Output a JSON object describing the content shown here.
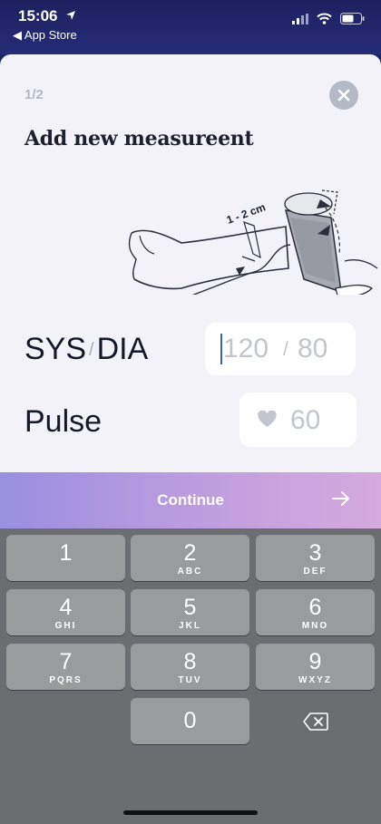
{
  "status_bar": {
    "time": "15:06",
    "back_label": "◀ App Store"
  },
  "sheet": {
    "step": "1/2",
    "title": "Add new measureent",
    "illustration": {
      "cuff_label": "1 - 2 cm"
    }
  },
  "sysdia": {
    "label_sys": "SYS",
    "label_sep": "/",
    "label_dia": "DIA",
    "sys_placeholder": "120",
    "slash": "/",
    "dia_placeholder": "80"
  },
  "pulse": {
    "label": "Pulse",
    "placeholder": "60",
    "icon": "heart-icon"
  },
  "continue": {
    "label": "Continue",
    "icon": "arrow-right-icon"
  },
  "keyboard": {
    "keys": [
      {
        "num": "1",
        "letters": ""
      },
      {
        "num": "2",
        "letters": "ABC"
      },
      {
        "num": "3",
        "letters": "DEF"
      },
      {
        "num": "4",
        "letters": "GHI"
      },
      {
        "num": "5",
        "letters": "JKL"
      },
      {
        "num": "6",
        "letters": "MNO"
      },
      {
        "num": "7",
        "letters": "PQRS"
      },
      {
        "num": "8",
        "letters": "TUV"
      },
      {
        "num": "9",
        "letters": "WXYZ"
      },
      {
        "num": "0",
        "letters": ""
      }
    ]
  },
  "colors": {
    "accent_start": "#9a8fe0",
    "accent_end": "#d6a9df",
    "caret": "#3a5fd0"
  }
}
